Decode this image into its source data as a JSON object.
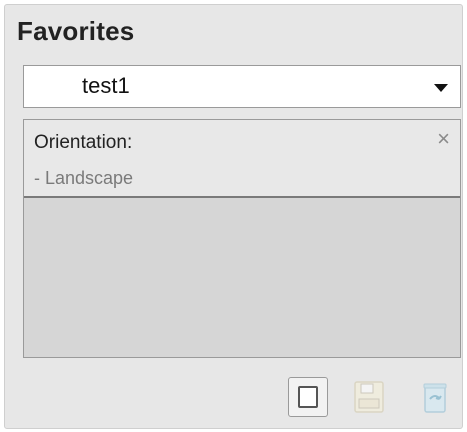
{
  "favorites": {
    "title": "Favorites",
    "selected": "test1",
    "items": [
      {
        "title": "Orientation:",
        "value": "- Landscape"
      }
    ]
  },
  "buttons": {
    "new_icon": "new-document-icon",
    "save_icon": "save-icon",
    "delete_icon": "recycle-bin-icon"
  },
  "colors": {
    "panel_bg": "#e7e7e7",
    "list_bg": "#d6d6d6",
    "item_bg": "#e8e8e8",
    "text": "#222222",
    "muted": "#7a7a7a"
  }
}
